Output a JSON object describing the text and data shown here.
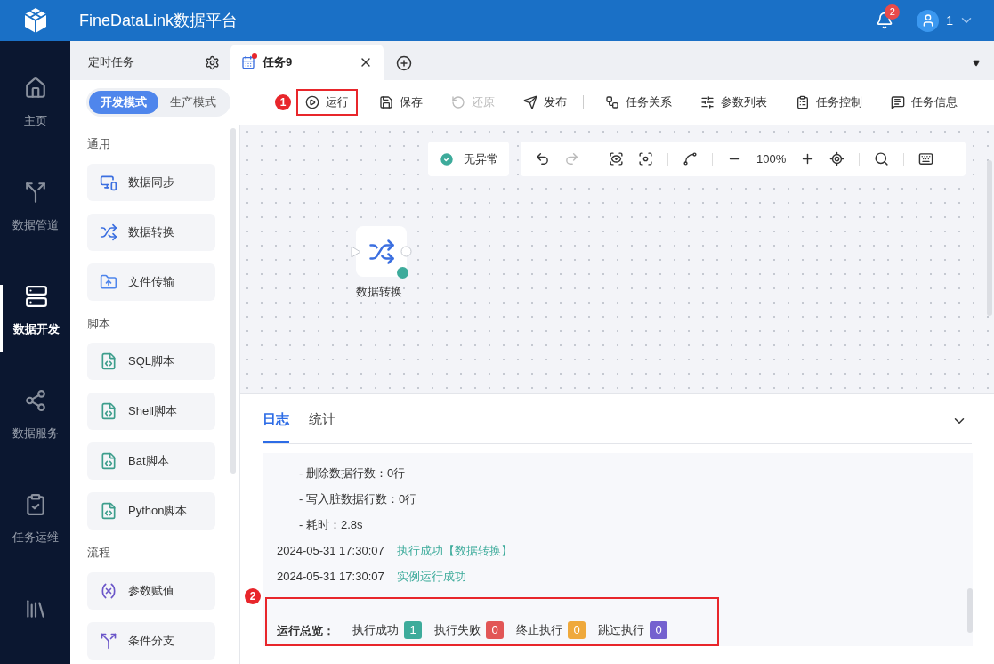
{
  "header": {
    "title": "FineDataLink数据平台",
    "notifications": "2",
    "user": "1"
  },
  "nav": [
    {
      "label": "主页",
      "kind": "home",
      "selected": false
    },
    {
      "label": "数据管道",
      "kind": "pipe",
      "selected": false
    },
    {
      "label": "数据开发",
      "kind": "dev",
      "selected": true
    },
    {
      "label": "数据服务",
      "kind": "service",
      "selected": false
    },
    {
      "label": "任务运维",
      "kind": "ops",
      "selected": false
    },
    {
      "kind": "book",
      "selected": false
    }
  ],
  "tabs": [
    {
      "label": "定时任务",
      "kind": "settings",
      "selected": false
    },
    {
      "label": "任务9",
      "kind": "task",
      "selected": true
    }
  ],
  "modes": [
    {
      "label": "开发模式",
      "selected": true
    },
    {
      "label": "生产模式",
      "selected": false
    }
  ],
  "toolbar": [
    {
      "label": "运行",
      "kind": "play",
      "disabled": false,
      "annotation": "1"
    },
    {
      "label": "保存",
      "kind": "save",
      "disabled": false
    },
    {
      "label": "还原",
      "kind": "restore",
      "disabled": true
    },
    {
      "label": "发布",
      "kind": "send",
      "disabled": false
    },
    {
      "label": "任务关系",
      "kind": "relation",
      "disabled": false
    },
    {
      "label": "参数列表",
      "kind": "params",
      "disabled": false
    },
    {
      "label": "任务控制",
      "kind": "control",
      "disabled": false
    },
    {
      "label": "任务信息",
      "kind": "info",
      "disabled": false
    }
  ],
  "palette": [
    {
      "title": "通用",
      "items": [
        {
          "label": "数据同步",
          "kind": "sync"
        },
        {
          "label": "数据转换",
          "kind": "transform"
        },
        {
          "label": "文件传输",
          "kind": "file"
        }
      ]
    },
    {
      "title": "脚本",
      "items": [
        {
          "label": "SQL脚本",
          "kind": "script"
        },
        {
          "label": "Shell脚本",
          "kind": "script"
        },
        {
          "label": "Bat脚本",
          "kind": "script"
        },
        {
          "label": "Python脚本",
          "kind": "script"
        }
      ]
    },
    {
      "title": "流程",
      "items": [
        {
          "label": "参数赋值",
          "kind": "assign"
        },
        {
          "label": "条件分支",
          "kind": "branch"
        }
      ]
    }
  ],
  "canvas": {
    "status": "无异常",
    "zoom": "100%",
    "node": {
      "label": "数据转换",
      "color": "#3dab9b"
    }
  },
  "log": {
    "tabs": [
      {
        "label": "日志",
        "selected": true
      },
      {
        "label": "统计",
        "selected": false
      }
    ],
    "lines": [
      {
        "kind": "detail",
        "text": "- 删除数据行数：0行"
      },
      {
        "kind": "detail",
        "text": "- 写入脏数据行数：0行"
      },
      {
        "kind": "detail",
        "text": "- 耗时：2.8s"
      },
      {
        "kind": "event",
        "time": "2024-05-31 17:30:07",
        "message": "执行成功【数据转换】"
      },
      {
        "kind": "event",
        "time": "2024-05-31 17:30:07",
        "message": "实例运行成功"
      }
    ],
    "summary": {
      "label": "运行总览：",
      "annotation": "2",
      "items": [
        {
          "label": "执行成功",
          "count": "1",
          "color": "#3dab9b"
        },
        {
          "label": "执行失败",
          "count": "0",
          "color": "#e25656"
        },
        {
          "label": "终止执行",
          "count": "0",
          "color": "#efa93c"
        },
        {
          "label": "跳过执行",
          "count": "0",
          "color": "#7461cf"
        }
      ]
    }
  }
}
